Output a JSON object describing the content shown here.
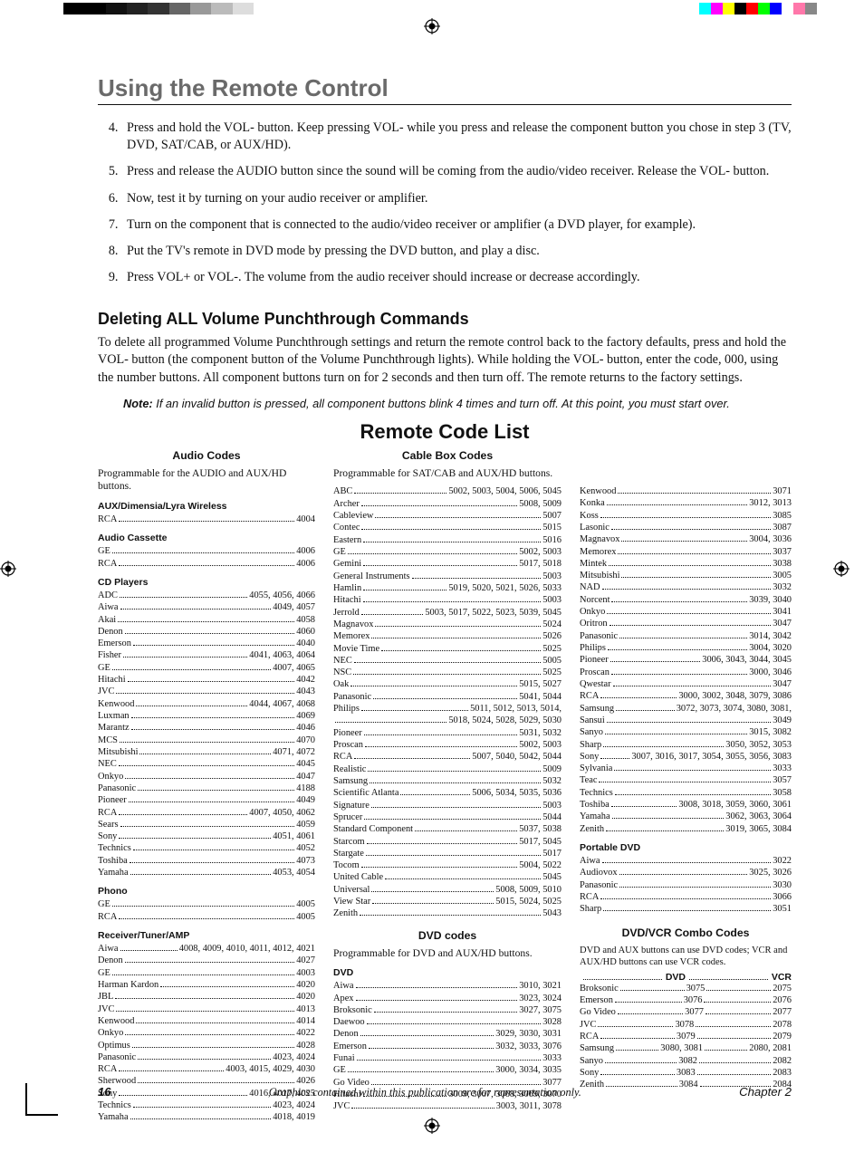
{
  "chapter_title": "Using the Remote Control",
  "steps_start": 4,
  "steps": [
    "Press and hold the VOL- button. Keep pressing VOL- while you press and release the component button you chose in step 3 (TV, DVD, SAT/CAB, or AUX/HD).",
    "Press and release the AUDIO button since the sound will be coming from the audio/video receiver. Release the VOL- button.",
    "Now, test it by turning on your audio receiver or amplifier.",
    "Turn on the component that is connected to the audio/video receiver or amplifier (a DVD player, for example).",
    "Put the TV's remote in DVD mode by pressing the DVD button, and play a disc.",
    "Press VOL+ or VOL-. The volume from the audio receiver should increase or decrease accordingly."
  ],
  "sub_heading": "Deleting ALL Volume Punchthrough Commands",
  "sub_body": "To delete all programmed Volume Punchthrough settings and return the remote control back to the factory defaults, press and hold the VOL- button (the component button of the Volume Punchthrough lights). While holding the VOL- button, enter the code, 000, using the number buttons. All component buttons turn on for 2 seconds and then turn off. The remote returns to the factory settings.",
  "note_label": "Note:",
  "note_body": "If an invalid button is pressed, all component buttons blink 4 times and turn off. At this point, you must start over.",
  "remote_code_list_title": "Remote Code List",
  "audio_codes_title": "Audio Codes",
  "cable_box_title": "Cable Box Codes",
  "dvd_codes_title": "DVD codes",
  "combo_title": "DVD/VCR Combo Codes",
  "audio_prog": "Programmable for the AUDIO and AUX/HD buttons.",
  "cable_prog": "Programmable for SAT/CAB and AUX/HD buttons.",
  "dvd_prog": "Programmable for DVD and AUX/HD buttons.",
  "combo_note": "DVD and AUX buttons can use DVD codes; VCR and AUX/HD buttons can use VCR codes.",
  "combo_head_dvd": "DVD",
  "combo_head_vcr": "VCR",
  "audio_groups": [
    {
      "head": "AUX/Dimensia/Lyra Wireless",
      "rows": [
        [
          "RCA",
          "4004"
        ]
      ]
    },
    {
      "head": "Audio Cassette",
      "rows": [
        [
          "GE",
          "4006"
        ],
        [
          "RCA",
          "4006"
        ]
      ]
    },
    {
      "head": "CD Players",
      "rows": [
        [
          "ADC",
          "4055, 4056, 4066"
        ],
        [
          "Aiwa",
          "4049, 4057"
        ],
        [
          "Akai",
          "4058"
        ],
        [
          "Denon",
          "4060"
        ],
        [
          "Emerson",
          "4040"
        ],
        [
          "Fisher",
          "4041, 4063, 4064"
        ],
        [
          "GE",
          "4007, 4065"
        ],
        [
          "Hitachi",
          "4042"
        ],
        [
          "JVC",
          "4043"
        ],
        [
          "Kenwood",
          "4044, 4067, 4068"
        ],
        [
          "Luxman",
          "4069"
        ],
        [
          "Marantz",
          "4046"
        ],
        [
          "MCS",
          "4070"
        ],
        [
          "Mitsubishi",
          "4071, 4072"
        ],
        [
          "NEC",
          "4045"
        ],
        [
          "Onkyo",
          "4047"
        ],
        [
          "Panasonic",
          "4188"
        ],
        [
          "Pioneer",
          "4049"
        ],
        [
          "RCA",
          "4007, 4050, 4062"
        ],
        [
          "Sears",
          "4059"
        ],
        [
          "Sony",
          "4051, 4061"
        ],
        [
          "Technics",
          "4052"
        ],
        [
          "Toshiba",
          "4073"
        ],
        [
          "Yamaha",
          "4053, 4054"
        ]
      ]
    },
    {
      "head": "Phono",
      "rows": [
        [
          "GE",
          "4005"
        ],
        [
          "RCA",
          "4005"
        ]
      ]
    },
    {
      "head": "Receiver/Tuner/AMP",
      "rows": [
        [
          "Aiwa",
          "4008, 4009, 4010, 4011, 4012, 4021"
        ],
        [
          "Denon",
          "4027"
        ],
        [
          "GE",
          "4003"
        ],
        [
          "Harman Kardon",
          "4020"
        ],
        [
          "JBL",
          "4020"
        ],
        [
          "JVC",
          "4013"
        ],
        [
          "Kenwood",
          "4014"
        ],
        [
          "Onkyo",
          "4022"
        ],
        [
          "Optimus",
          "4028"
        ],
        [
          "Panasonic",
          "4023, 4024"
        ],
        [
          "RCA",
          "4003, 4015, 4029, 4030"
        ],
        [
          "Sherwood",
          "4026"
        ],
        [
          "Sony",
          "4016, 4017, 4025"
        ],
        [
          "Technics",
          "4023, 4024"
        ],
        [
          "Yamaha",
          "4018, 4019"
        ]
      ]
    }
  ],
  "cable_rows": [
    [
      "ABC",
      "5002, 5003, 5004, 5006, 5045"
    ],
    [
      "Archer",
      "5008, 5009"
    ],
    [
      "Cableview",
      "5007"
    ],
    [
      "Contec",
      "5015"
    ],
    [
      "Eastern",
      "5016"
    ],
    [
      "GE",
      "5002, 5003"
    ],
    [
      "Gemini",
      "5017, 5018"
    ],
    [
      "General Instruments",
      "5003"
    ],
    [
      "Hamlin",
      "5019, 5020, 5021, 5026, 5033"
    ],
    [
      "Hitachi",
      "5003"
    ],
    [
      "Jerrold",
      "5003, 5017, 5022, 5023, 5039, 5045"
    ],
    [
      "Magnavox",
      "5024"
    ],
    [
      "Memorex",
      "5026"
    ],
    [
      "Movie Time",
      "5025"
    ],
    [
      "NEC",
      "5005"
    ],
    [
      "NSC",
      "5025"
    ],
    [
      "Oak",
      "5015, 5027"
    ],
    [
      "Panasonic",
      "5041, 5044"
    ],
    [
      "Philips",
      "5011, 5012, 5013, 5014,"
    ],
    [
      "",
      "5018, 5024, 5028, 5029, 5030"
    ],
    [
      "Pioneer",
      "5031, 5032"
    ],
    [
      "Proscan",
      "5002, 5003"
    ],
    [
      "RCA",
      "5007, 5040, 5042, 5044"
    ],
    [
      "Realistic",
      "5009"
    ],
    [
      "Samsung",
      "5032"
    ],
    [
      "Scientific Atlanta",
      "5006, 5034, 5035, 5036"
    ],
    [
      "Signature",
      "5003"
    ],
    [
      "Sprucer",
      "5044"
    ],
    [
      "Standard Component",
      "5037, 5038"
    ],
    [
      "Starcom",
      "5017, 5045"
    ],
    [
      "Stargate",
      "5017"
    ],
    [
      "Tocom",
      "5004, 5022"
    ],
    [
      "United Cable",
      "5045"
    ],
    [
      "Universal",
      "5008, 5009, 5010"
    ],
    [
      "View Star",
      "5015, 5024, 5025"
    ],
    [
      "Zenith",
      "5043"
    ]
  ],
  "dvd_rows": [
    [
      "Aiwa",
      "3010, 3021"
    ],
    [
      "Apex",
      "3023, 3024"
    ],
    [
      "Broksonic",
      "3027, 3075"
    ],
    [
      "Daewoo",
      "3028"
    ],
    [
      "Denon",
      "3029, 3030, 3031"
    ],
    [
      "Emerson",
      "3032, 3033, 3076"
    ],
    [
      "Funai",
      "3033"
    ],
    [
      "GE",
      "3000, 3034, 3035"
    ],
    [
      "Go Video",
      "3077"
    ],
    [
      "Hitachi",
      "3009, 3067, 3068, 3069, 3070"
    ],
    [
      "JVC",
      "3003, 3011, 3078"
    ]
  ],
  "dvd_head": "DVD",
  "colC_rows": [
    [
      "Kenwood",
      "3071"
    ],
    [
      "Konka",
      "3012, 3013"
    ],
    [
      "Koss",
      "3085"
    ],
    [
      "Lasonic",
      "3087"
    ],
    [
      "Magnavox",
      "3004, 3036"
    ],
    [
      "Memorex",
      "3037"
    ],
    [
      "Mintek",
      "3038"
    ],
    [
      "Mitsubishi",
      "3005"
    ],
    [
      "NAD",
      "3032"
    ],
    [
      "Norcent",
      "3039, 3040"
    ],
    [
      "Onkyo",
      "3041"
    ],
    [
      "Oritron",
      "3047"
    ],
    [
      "Panasonic",
      "3014, 3042"
    ],
    [
      "Philips",
      "3004, 3020"
    ],
    [
      "Pioneer",
      "3006, 3043, 3044, 3045"
    ],
    [
      "Proscan",
      "3000, 3046"
    ],
    [
      "Qwestar",
      "3047"
    ],
    [
      "RCA",
      "3000, 3002, 3048, 3079, 3086"
    ],
    [
      "Samsung",
      "3072, 3073, 3074, 3080, 3081,"
    ],
    [
      "Sansui",
      "3049"
    ],
    [
      "Sanyo",
      "3015, 3082"
    ],
    [
      "Sharp",
      "3050, 3052, 3053"
    ],
    [
      "Sony",
      "3007, 3016, 3017, 3054, 3055, 3056, 3083"
    ],
    [
      "Sylvania",
      "3033"
    ],
    [
      "Teac",
      "3057"
    ],
    [
      "Technics",
      "3058"
    ],
    [
      "Toshiba",
      "3008, 3018, 3059, 3060, 3061"
    ],
    [
      "Yamaha",
      "3062, 3063, 3064"
    ],
    [
      "Zenith",
      "3019, 3065, 3084"
    ]
  ],
  "portable_head": "Portable DVD",
  "portable_rows": [
    [
      "Aiwa",
      "3022"
    ],
    [
      "Audiovox",
      "3025, 3026"
    ],
    [
      "Panasonic",
      "3030"
    ],
    [
      "RCA",
      "3066"
    ],
    [
      "Sharp",
      "3051"
    ]
  ],
  "combo_rows": [
    [
      "Broksonic",
      "3075",
      "2075"
    ],
    [
      "Emerson",
      "3076",
      "2076"
    ],
    [
      "Go Video",
      "3077",
      "2077"
    ],
    [
      "JVC",
      "3078",
      "2078"
    ],
    [
      "RCA",
      "3079",
      "2079"
    ],
    [
      "Samsung",
      "3080, 3081",
      "2080, 2081"
    ],
    [
      "Sanyo",
      "3082",
      "2082"
    ],
    [
      "Sony",
      "3083",
      "2083"
    ],
    [
      "Zenith",
      "3084",
      "2084"
    ]
  ],
  "page_number": "16",
  "footer_mid": "Graphics contained within this publication are for representation only.",
  "footer_chap": "Chapter 2",
  "colorbar": [
    "#0ff",
    "#f0f",
    "#ff0",
    "#000",
    "#f00",
    "#0f0",
    "#00f",
    "#fff",
    "#f7a",
    "#888"
  ],
  "gradbar": [
    "#000",
    "#000",
    "#111",
    "#222",
    "#333",
    "#666",
    "#999",
    "#bbb",
    "#ddd"
  ]
}
